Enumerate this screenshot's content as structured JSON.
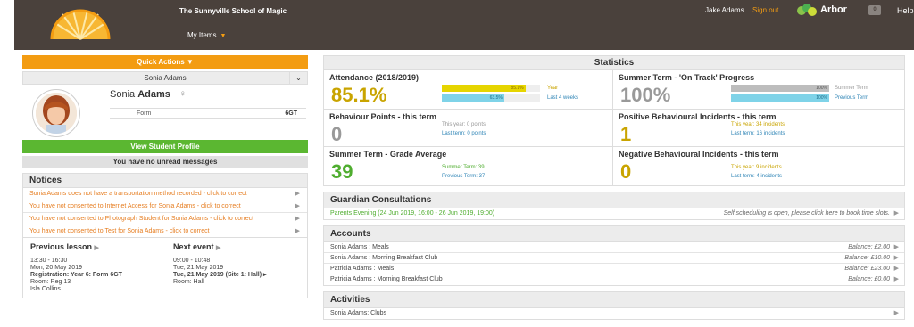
{
  "header": {
    "school_name": "The Sunnyville School of Magic",
    "my_items": "My Items",
    "user_name": "Jake Adams",
    "sign_out": "Sign out",
    "brand": "Arbor",
    "mail_count": "0",
    "help": "Help"
  },
  "left": {
    "quick_actions": "Quick Actions",
    "student_select": "Sonia Adams",
    "first_name": "Sonia",
    "last_name": "Adams",
    "form_label": "Form",
    "form_value": "6GT",
    "view_profile": "View Student Profile",
    "no_messages": "You have no unread messages",
    "notices_title": "Notices",
    "notices": [
      "Sonia Adams does not have a transportation method recorded - click to correct",
      "You have not consented to Internet Access for Sonia Adams - click to correct",
      "You have not consented to Photograph Student for Sonia Adams - click to correct",
      "You have not consented to Test for Sonia Adams - click to correct"
    ],
    "previous_lesson": {
      "title": "Previous lesson",
      "time": "13:30 - 16:30",
      "date": "Mon, 20 May 2019",
      "registration": "Registration: Year 6: Form 6GT",
      "room": "Room: Reg 13",
      "teacher": "Isla Collins"
    },
    "next_event": {
      "title": "Next event",
      "time": "09:00 - 10:48",
      "date": "Tue, 21 May 2019",
      "event": "Tue, 21 May 2019 (Site 1: Hall)",
      "room": "Room: Hall"
    }
  },
  "stats": {
    "title": "Statistics",
    "attendance": {
      "title": "Attendance (2018/2019)",
      "value": "85.1%",
      "year_bar": "85.1%",
      "year_label": "Year",
      "weeks_bar": "63.5%",
      "weeks_label": "Last 4 weeks",
      "year_pct": 85.1,
      "weeks_pct": 63.5
    },
    "on_track": {
      "title": "Summer Term - 'On Track' Progress",
      "value": "100%",
      "summer_bar": "100%",
      "summer_label": "Summer Term",
      "prev_bar": "100%",
      "prev_label": "Previous Term",
      "summer_pct": 100,
      "prev_pct": 100
    },
    "behaviour": {
      "title": "Behaviour Points - this term",
      "value": "0",
      "this_term": "This year: 0 points",
      "last_term": "Last term: 0 points"
    },
    "positive": {
      "title": "Positive Behavioural Incidents - this term",
      "value": "1",
      "this_term": "This year: 34 incidents",
      "last_term": "Last term: 16 incidents"
    },
    "grade": {
      "title": "Summer Term - Grade Average",
      "value": "39",
      "summer": "Summer Term: 39",
      "previous": "Previous Term: 37"
    },
    "negative": {
      "title": "Negative Behavioural Incidents - this term",
      "value": "0",
      "this_term": "This year: 9 incidents",
      "last_term": "Last term: 4 incidents"
    }
  },
  "guardian": {
    "title": "Guardian Consultations",
    "event": "Parents Evening (24 Jun 2019, 16:00 - 26 Jun 2019, 19:00)",
    "note": "Self scheduling is open, please click here to book time slots."
  },
  "accounts": {
    "title": "Accounts",
    "rows": [
      {
        "name": "Sonia Adams : Meals",
        "balance": "Balance: £2.00"
      },
      {
        "name": "Sonia Adams : Morning Breakfast Club",
        "balance": "Balance: £10.00"
      },
      {
        "name": "Patricia Adams : Meals",
        "balance": "Balance: £23.00"
      },
      {
        "name": "Patricia Adams : Morning Breakfast Club",
        "balance": "Balance: £0.00"
      }
    ]
  },
  "activities": {
    "title": "Activities",
    "rows": [
      {
        "name": "Sonia Adams: Clubs"
      }
    ]
  },
  "colors": {
    "header_bg": "#4a413c",
    "orange": "#f39c12",
    "green": "#5bb731",
    "gold": "#c9a400",
    "cyan": "#5bc0de"
  }
}
